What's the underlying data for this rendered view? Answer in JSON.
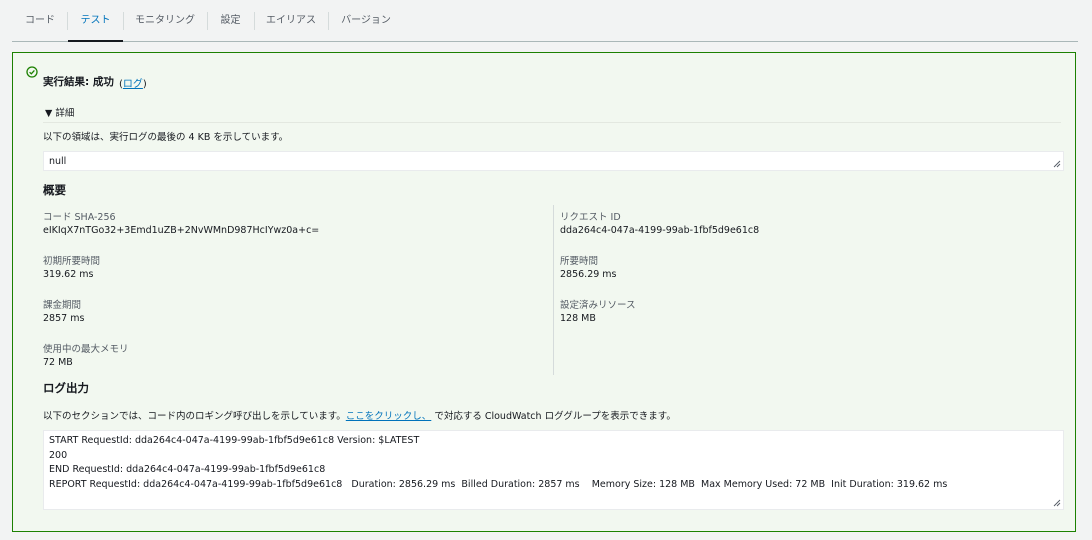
{
  "tabs": [
    {
      "label": "コード"
    },
    {
      "label": "テスト"
    },
    {
      "label": "モニタリング"
    },
    {
      "label": "設定"
    },
    {
      "label": "エイリアス"
    },
    {
      "label": "バージョン"
    }
  ],
  "active_tab": "テスト",
  "result": {
    "title": "実行結果: 成功",
    "log_open": "(",
    "log_link": "ログ",
    "log_close": ")",
    "status_color": "#1d8102",
    "icon": "check-circle-icon"
  },
  "details": {
    "toggle_label": "▼ 詳細",
    "description": "以下の領域は、実行ログの最後の 4 KB を示しています。",
    "output": "null"
  },
  "summary": {
    "heading": "概要",
    "items": [
      {
        "label": "コード SHA-256",
        "value": "eIKIqX7nTGo32+3Emd1uZB+2NvWMnD987HcIYwz0a+c="
      },
      {
        "label": "リクエスト ID",
        "value": "dda264c4-047a-4199-99ab-1fbf5d9e61c8"
      },
      {
        "label": "初期所要時間",
        "value": "319.62 ms"
      },
      {
        "label": "所要時間",
        "value": "2856.29 ms"
      },
      {
        "label": "課金期間",
        "value": "2857 ms"
      },
      {
        "label": "設定済みリソース",
        "value": "128 MB"
      },
      {
        "label": "使用中の最大メモリ",
        "value": "72 MB"
      }
    ]
  },
  "log_output": {
    "heading": "ログ出力",
    "desc_before": "以下のセクションでは、コード内のロギング呼び出しを示しています。",
    "desc_link": "ここをクリックし、",
    "desc_after": " で対応する CloudWatch ロググループを表示できます。",
    "lines": [
      "START RequestId: dda264c4-047a-4199-99ab-1fbf5d9e61c8 Version: $LATEST",
      "200",
      "END RequestId: dda264c4-047a-4199-99ab-1fbf5d9e61c8",
      "REPORT RequestId: dda264c4-047a-4199-99ab-1fbf5d9e61c8   Duration: 2856.29 ms  Billed Duration: 2857 ms    Memory Size: 128 MB  Max Memory Used: 72 MB  Init Duration: 319.62 ms"
    ]
  }
}
